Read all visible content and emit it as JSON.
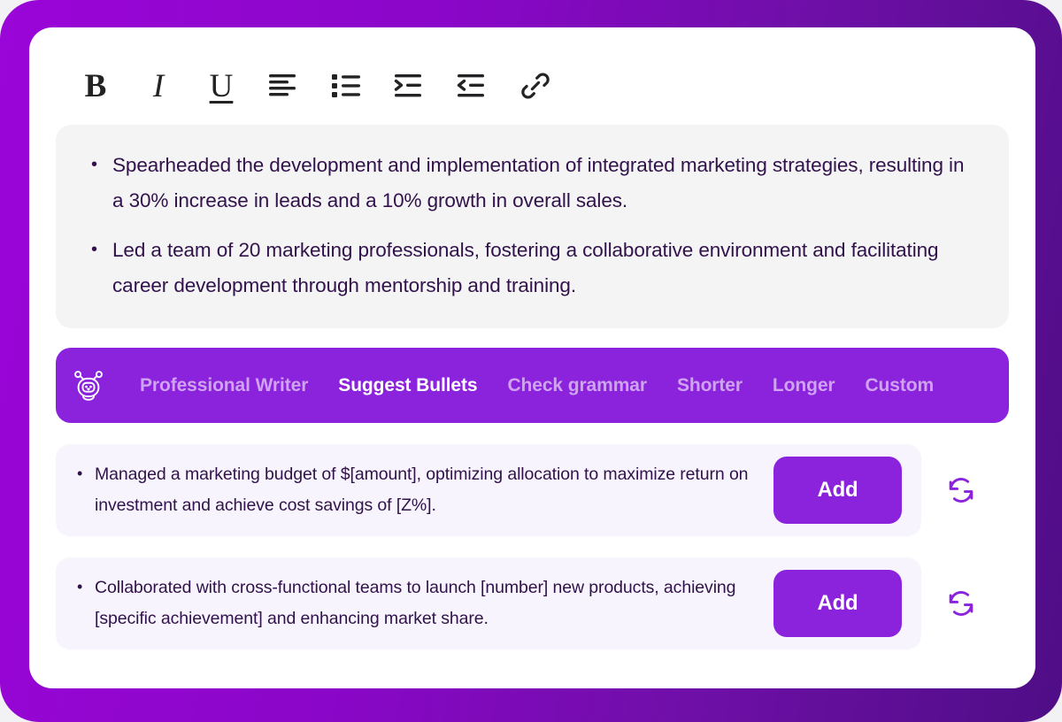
{
  "theme": {
    "frame_gradient_start": "#9a05d8",
    "frame_gradient_end": "#4f0d86",
    "accent_purple": "#8b22dc",
    "text_dark": "#31124a",
    "inactive_action": "#cfa3ef",
    "editor_bg": "#f4f4f5",
    "suggestion_bg": "#f7f4fd"
  },
  "toolbar": {
    "items": [
      {
        "name": "bold-icon",
        "label": "B",
        "title": "Bold"
      },
      {
        "name": "italic-icon",
        "label": "I",
        "title": "Italic"
      },
      {
        "name": "underline-icon",
        "label": "U",
        "title": "Underline"
      },
      {
        "name": "align-left-icon",
        "label": "",
        "title": "Align left"
      },
      {
        "name": "bulleted-list-icon",
        "label": "",
        "title": "Bulleted list"
      },
      {
        "name": "indent-increase-icon",
        "label": "",
        "title": "Increase indent"
      },
      {
        "name": "indent-decrease-icon",
        "label": "",
        "title": "Decrease indent"
      },
      {
        "name": "link-icon",
        "label": "",
        "title": "Insert link"
      }
    ]
  },
  "editor": {
    "bullets": [
      "Spearheaded the development and implementation of integrated marketing strategies, resulting in a 30% increase in leads and a 10% growth in overall sales.",
      "Led a team of 20 marketing professionals, fostering a collaborative environment and facilitating career development through mentorship and training."
    ]
  },
  "ai_bar": {
    "icon": "robot-icon",
    "actions": [
      {
        "label": "Professional Writer",
        "active": false
      },
      {
        "label": "Suggest Bullets",
        "active": true
      },
      {
        "label": "Check grammar",
        "active": false
      },
      {
        "label": "Shorter",
        "active": false
      },
      {
        "label": "Longer",
        "active": false
      },
      {
        "label": "Custom",
        "active": false
      }
    ]
  },
  "suggestions": {
    "add_label": "Add",
    "refresh_icon": "refresh-icon",
    "items": [
      {
        "text": "Managed a marketing budget of $[amount], optimizing allocation to maximize return on investment and achieve cost savings of [Z%]."
      },
      {
        "text": "Collaborated with cross-functional teams to launch [number] new products, achieving [specific achievement] and enhancing market share."
      }
    ]
  }
}
